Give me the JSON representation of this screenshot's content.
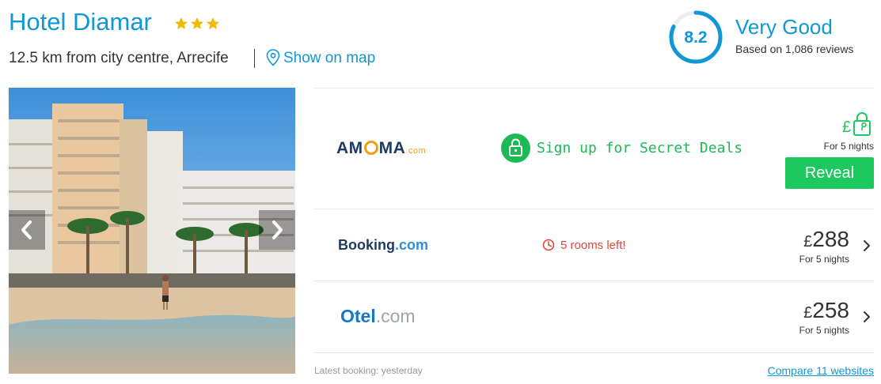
{
  "hotel": {
    "name": "Hotel Diamar",
    "star_rating": 3,
    "location_text": "12.5 km from city centre, Arrecife",
    "map_link": "Show on map"
  },
  "rating": {
    "score": "8.2",
    "label": "Very Good",
    "reviews": "Based on 1,086 reviews",
    "score_fraction": 0.82,
    "accent_color": "#0f97d6"
  },
  "gallery": {
    "prev_icon": "chevron-left-icon",
    "next_icon": "chevron-right-icon"
  },
  "deals": [
    {
      "provider_logo_main_left": "AM",
      "provider_logo_main_right": "MA",
      "provider_logo_suffix": ".com",
      "secret_text": "Sign up for Secret Deals",
      "currency": "£",
      "nights": "For 5 nights",
      "button": "Reveal",
      "color": "#1dc85e"
    },
    {
      "provider_logo_main": "Booking",
      "provider_logo_suffix": ".com",
      "availability": "5 rooms left!",
      "currency": "£",
      "price": "288",
      "nights": "For 5 nights"
    },
    {
      "provider_logo_main": "Otel",
      "provider_logo_suffix": ".com",
      "currency": "£",
      "price": "258",
      "nights": "For 5 nights"
    }
  ],
  "footer": {
    "latest_booking": "Latest booking: yesterday",
    "compare_link": "Compare 11 websites"
  }
}
